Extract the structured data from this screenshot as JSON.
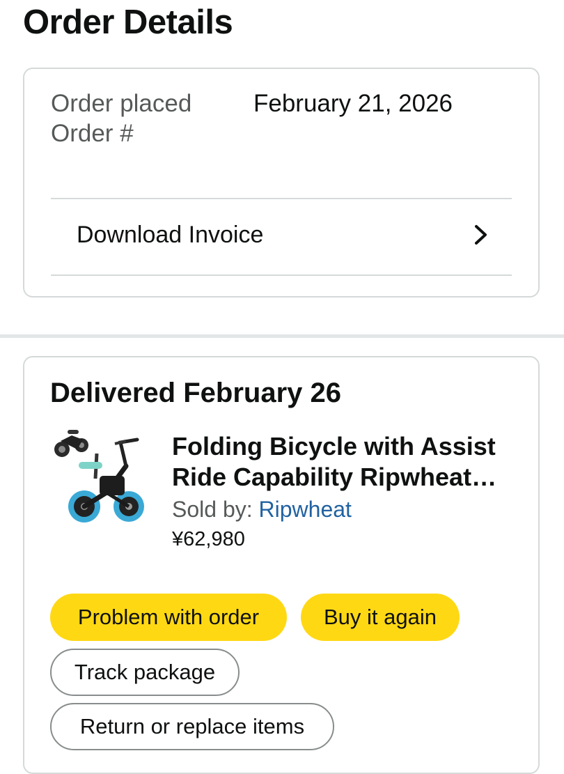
{
  "page": {
    "title": "Order Details"
  },
  "order_summary": {
    "order_placed_label": "Order placed",
    "order_placed_value": "February 21, 2026",
    "order_number_label": "Order #",
    "invoice_label": "Download Invoice",
    "invoice_icon": "chevron-right-icon"
  },
  "shipment": {
    "delivery_status": "Delivered February 26",
    "item": {
      "title": "Folding Bicycle with Assist Ride Capability Ripwheat Foldable Electric Bike",
      "sold_by_label": "Sold by: ",
      "seller": "Ripwheat",
      "price": "¥62,980",
      "image": "folding-bicycle-image"
    },
    "actions": {
      "problem": "Problem with order",
      "buy_again": "Buy it again",
      "track": "Track package",
      "return": "Return or replace items"
    }
  },
  "colors": {
    "primary_button": "#ffd814",
    "link": "#2162a1",
    "border": "#d5d9d9",
    "secondary_text": "#565959"
  }
}
